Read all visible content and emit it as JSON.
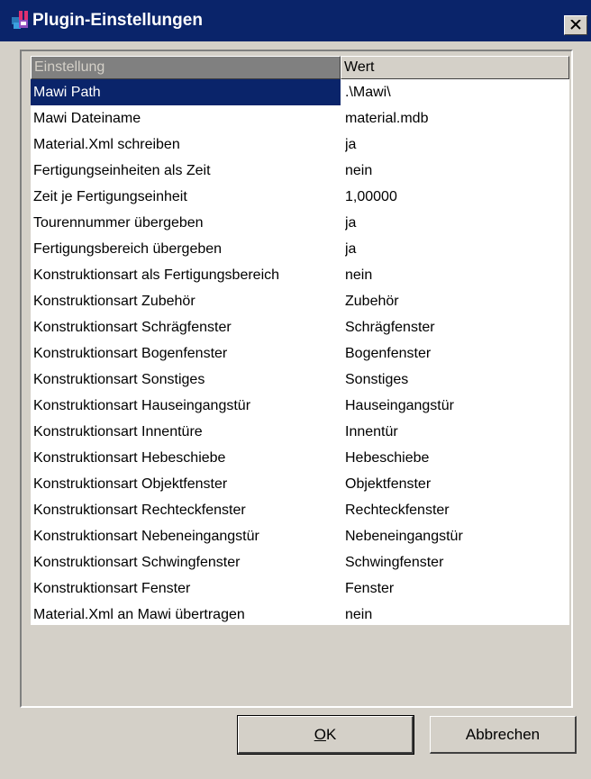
{
  "window": {
    "title": "Plugin-Einstellungen",
    "icon": "plugin-app-icon",
    "close_icon": "close-x-icon"
  },
  "grid": {
    "headers": {
      "setting": "Einstellung",
      "value": "Wert"
    },
    "rows": [
      {
        "setting": "Mawi Path",
        "value": ".\\Mawi\\",
        "selected": true
      },
      {
        "setting": "Mawi Dateiname",
        "value": "material.mdb"
      },
      {
        "setting": "Material.Xml schreiben",
        "value": "ja"
      },
      {
        "setting": "Fertigungseinheiten als Zeit",
        "value": "nein"
      },
      {
        "setting": "Zeit je Fertigungseinheit",
        "value": "1,00000"
      },
      {
        "setting": "Tourennummer übergeben",
        "value": "ja"
      },
      {
        "setting": "Fertigungsbereich übergeben",
        "value": "ja"
      },
      {
        "setting": "Konstruktionsart als Fertigungsbereich",
        "value": "nein"
      },
      {
        "setting": "Konstruktionsart Zubehör",
        "value": "Zubehör"
      },
      {
        "setting": "Konstruktionsart Schrägfenster",
        "value": "Schrägfenster"
      },
      {
        "setting": "Konstruktionsart Bogenfenster",
        "value": "Bogenfenster"
      },
      {
        "setting": "Konstruktionsart Sonstiges",
        "value": "Sonstiges"
      },
      {
        "setting": "Konstruktionsart Hauseingangstür",
        "value": "Hauseingangstür"
      },
      {
        "setting": "Konstruktionsart Innentüre",
        "value": "Innentür"
      },
      {
        "setting": "Konstruktionsart Hebeschiebe",
        "value": "Hebeschiebe"
      },
      {
        "setting": "Konstruktionsart Objektfenster",
        "value": "Objektfenster"
      },
      {
        "setting": "Konstruktionsart Rechteckfenster",
        "value": "Rechteckfenster"
      },
      {
        "setting": "Konstruktionsart Nebeneingangstür",
        "value": "Nebeneingangstür"
      },
      {
        "setting": "Konstruktionsart Schwingfenster",
        "value": "Schwingfenster"
      },
      {
        "setting": "Konstruktionsart Fenster",
        "value": "Fenster"
      },
      {
        "setting": "Material.Xml an Mawi übertragen",
        "value": "nein"
      }
    ]
  },
  "buttons": {
    "ok_mnemonic": "O",
    "ok_rest": "K",
    "cancel": "Abbrechen"
  },
  "colors": {
    "titlebar": "#0a246a",
    "selection": "#0a246a",
    "face": "#d4d0c8"
  }
}
